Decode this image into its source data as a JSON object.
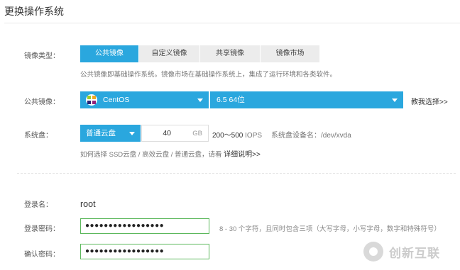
{
  "header": {
    "title": "更换操作系统"
  },
  "image_type": {
    "label": "镜像类型：",
    "tabs": [
      "公共镜像",
      "自定义镜像",
      "共享镜像",
      "镜像市场"
    ],
    "active_tab": "公共镜像",
    "hint": "公共镜像即基础操作系统。镜像市场在基础操作系统上，集成了运行环境和各类软件。"
  },
  "public_image": {
    "label": "公共镜像：",
    "os_value": "CentOS",
    "version_value": "6.5 64位",
    "help_link": "教我选择>>"
  },
  "system_disk": {
    "label": "系统盘：",
    "type_value": "普通云盘",
    "size_value": "40",
    "size_unit": "GB",
    "iops_range": "200～500",
    "iops_unit": "IOPS",
    "device_text": "系统盘设备名：/dev/xvda",
    "hint_prefix": "如何选择 SSD云盘 / 高效云盘 / 普通云盘，请看",
    "hint_link": "详细说明>>"
  },
  "login": {
    "name_label": "登录名：",
    "name_value": "root",
    "password_label": "登录密码：",
    "password_value": "●●●●●●●●●●●●●●●●●",
    "password_hint": "8 - 30 个字符，且同时包含三项（大写字母，小写字母，数字和特殊符号）",
    "confirm_label": "确认密码：",
    "confirm_value": "●●●●●●●●●●●●●●●●●"
  },
  "watermark": {
    "text": "创新互联"
  },
  "colors": {
    "accent": "#2aa7de",
    "valid_border": "#5cb85c"
  }
}
